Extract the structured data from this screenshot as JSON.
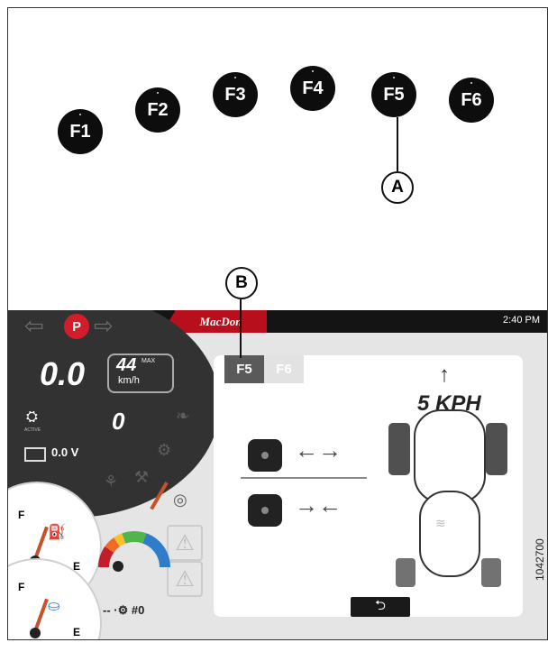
{
  "function_keys": [
    "F1",
    "F2",
    "F3",
    "F4",
    "F5",
    "F6"
  ],
  "callouts": {
    "a": "A",
    "b": "B"
  },
  "screen": {
    "brand": "MacDon",
    "clock": "2:40 PM",
    "park_indicator": "P",
    "ground_speed": "0.0",
    "max_speed": "44",
    "max_label": "MAX",
    "speed_unit": "km/h",
    "engine_value": "0",
    "engine_label": "ACTIVE",
    "battery_voltage": "0.0 V",
    "fuel_gauge": {
      "full": "F",
      "empty": "E"
    },
    "def_gauge": {
      "full": "F",
      "empty": "E"
    },
    "status_text": "-- ·⚙ #0",
    "tabs": [
      "F5",
      "F6"
    ],
    "target_speed": "5 KPH",
    "back_icon": "back-arrow"
  },
  "document_number": "1042700",
  "colors": {
    "brand_red": "#b70f1c",
    "park_red": "#d21e2b",
    "tab_active": "#5a5a5a",
    "tab_inactive": "#e2e2e2"
  }
}
